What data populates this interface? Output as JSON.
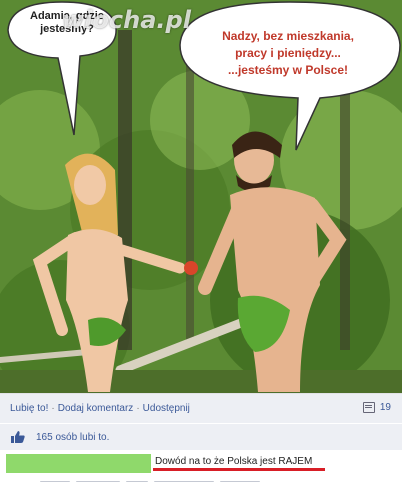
{
  "photo": {
    "watermark": "wiocha.pl",
    "bubble_left": "Adamie, gdzie jesteśmy?",
    "bubble_right": [
      "Nadzy, bez mieszkania,",
      "pracy i pieniędzy...",
      "...jesteśmy w Polsce!"
    ]
  },
  "actions": {
    "like": "Lubię to!",
    "comment": "Dodaj komentarz",
    "share": "Udostępnij",
    "comment_count": "19"
  },
  "likes": {
    "text": "165 osób lubi to."
  },
  "comment": {
    "text": "Dowód na to że Polska jest RAJEM"
  },
  "colors": {
    "link": "#3b5998",
    "bar_bg": "#edeff4",
    "highlight_green": "#8fd96b",
    "underline_red": "#d81e26"
  }
}
